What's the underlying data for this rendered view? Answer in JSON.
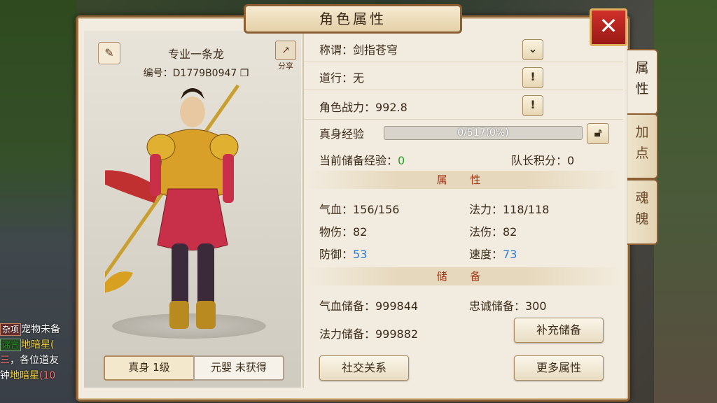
{
  "window": {
    "title": "角色属性",
    "close": "✕"
  },
  "side_tabs": [
    "属\n性",
    "加\n点",
    "魂\n魄"
  ],
  "character": {
    "name": "专业一条龙",
    "id_label": "编号：D1779B0947",
    "share_label": "分享",
    "tab_true_body": "真身 1级",
    "tab_yuanying": "元婴 未获得"
  },
  "info": {
    "title_label": "称谓：剑指苍穹",
    "daoxing_label": "道行：无",
    "power_label": "角色战力：992.8",
    "exp_label": "真身经验",
    "exp_text": "0/517(0%)",
    "exp_fraction": 0.0,
    "stored_exp_label": "当前储备经验：",
    "stored_exp_value": "0",
    "captain_label": "队长积分：0"
  },
  "attributes": {
    "header": "属 性",
    "hp": "气血：156/156",
    "mp": "法力：118/118",
    "phys_atk": "物伤：82",
    "mag_atk": "法伤：82",
    "defense_label": "防御：",
    "defense_value": "53",
    "speed_label": "速度：",
    "speed_value": "73"
  },
  "reserve": {
    "header": "储 备",
    "hp_reserve": "气血储备：999844",
    "loyalty_reserve": "忠诚储备：300",
    "mp_reserve": "法力储备：999882",
    "refill_button": "补充储备"
  },
  "buttons": {
    "social": "社交关系",
    "more_attrs": "更多属性"
  },
  "chat": {
    "line1_tag": "杂项",
    "line1_text": "宠物未备",
    "line2_tag": "谣言",
    "line2_text": "地暗星(",
    "line3_prefix": "三",
    "line3_text": "，各位道友",
    "line4_prefix": "钟",
    "line4_hl": "地暗星",
    "line4_text": "(10"
  },
  "colors": {
    "accent_green": "#2a9a2a",
    "accent_blue": "#2a7ad8",
    "section_red": "#a03a1a",
    "frame_brown": "#8b5e34"
  }
}
